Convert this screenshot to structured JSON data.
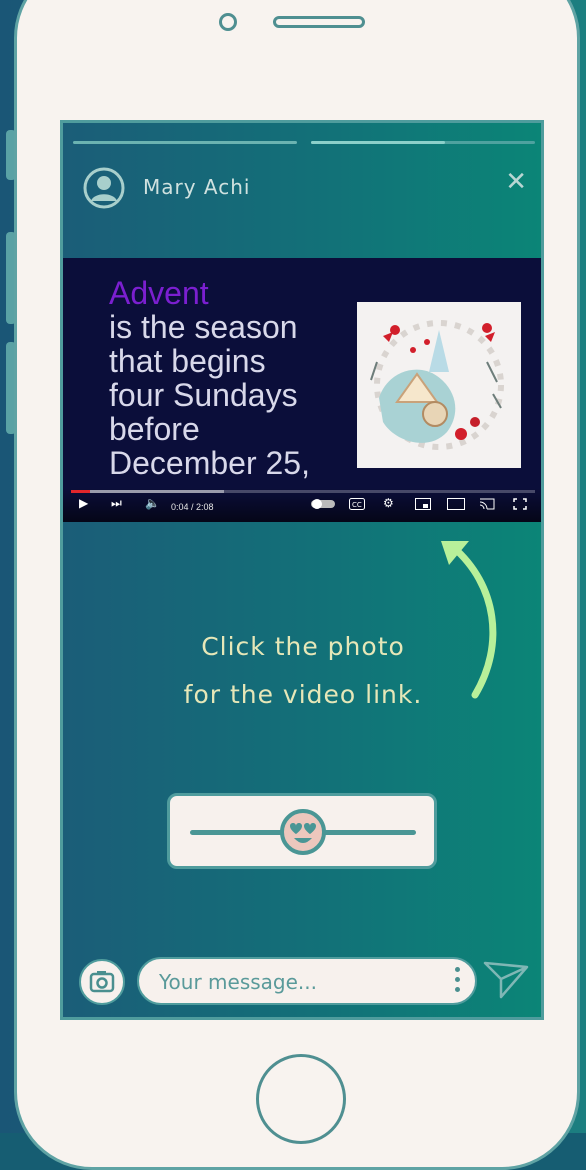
{
  "profile": {
    "name": "Mary Achi"
  },
  "video": {
    "heading": "Advent",
    "lines": [
      "is the season",
      "that begins",
      "four Sundays",
      "before",
      "December 25,"
    ],
    "time": "0:04 / 2:08",
    "progress_played": 0.04
  },
  "story": {
    "progress_current": 0.6
  },
  "caption": {
    "line1": "Click the photo",
    "line2": "for the video link."
  },
  "slider": {
    "value": 0.5
  },
  "composer": {
    "placeholder": "Your message..."
  },
  "colors": {
    "accent": "#4f9c9d",
    "caption": "#e6e7b8",
    "arrow": "#b8f09a"
  }
}
